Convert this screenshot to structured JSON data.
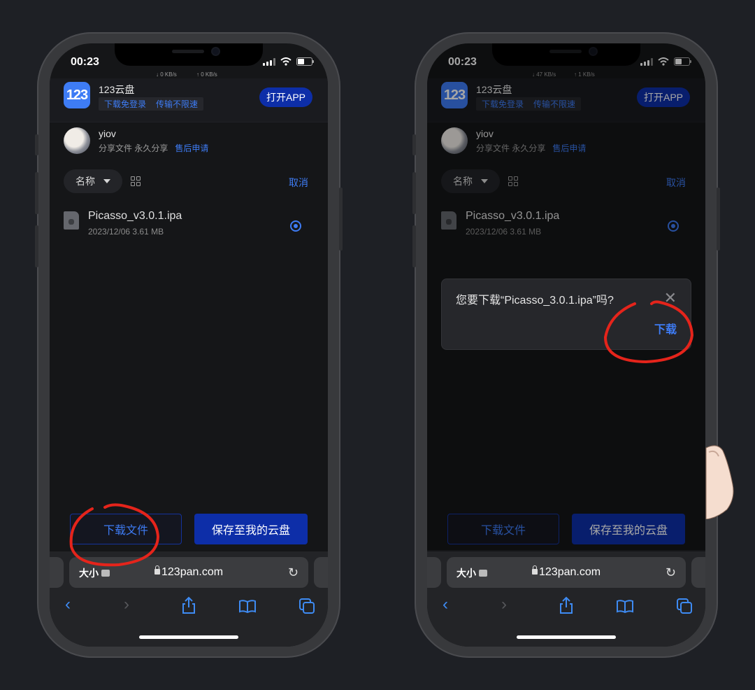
{
  "phones": {
    "left": {
      "status": {
        "time": "00:23",
        "speed_down": "↓ 0 KB/s",
        "speed_up": "↑ 0 KB/s"
      },
      "banner": {
        "logo": "123",
        "app_name": "123云盘",
        "tag1": "下载免登录",
        "tag2": "传输不限速",
        "open_app": "打开APP"
      },
      "user": {
        "name": "yiov",
        "meta": "分享文件 永久分享",
        "after_sale": "售后申请"
      },
      "toolbar": {
        "sort_label": "名称",
        "cancel": "取消"
      },
      "file": {
        "name": "Picasso_v3.0.1.ipa",
        "meta": "2023/12/06 3.61 MB"
      },
      "actions": {
        "download": "下载文件",
        "save": "保存至我的云盘"
      },
      "browser": {
        "text_size": "大小",
        "url": "123pan.com"
      }
    },
    "right": {
      "status": {
        "time": "00:23",
        "speed_down": "↓ 47 KB/s",
        "speed_up": "↑ 1 KB/s"
      },
      "banner": {
        "logo": "123",
        "app_name": "123云盘",
        "tag1": "下载免登录",
        "tag2": "传输不限速",
        "open_app": "打开APP"
      },
      "user": {
        "name": "yiov",
        "meta": "分享文件 永久分享",
        "after_sale": "售后申请"
      },
      "toolbar": {
        "sort_label": "名称",
        "cancel": "取消"
      },
      "file": {
        "name": "Picasso_v3.0.1.ipa",
        "meta": "2023/12/06 3.61 MB"
      },
      "actions": {
        "download": "下载文件",
        "save": "保存至我的云盘"
      },
      "browser": {
        "text_size": "大小",
        "url": "123pan.com"
      },
      "dialog": {
        "question": "您要下载“Picasso_3.0.1.ipa”吗?",
        "download": "下载"
      }
    }
  },
  "colors": {
    "accent": "#3e7cf5",
    "primary_button": "#0d2ea8",
    "annotation": "#e5241b",
    "background": "#1e2025"
  }
}
